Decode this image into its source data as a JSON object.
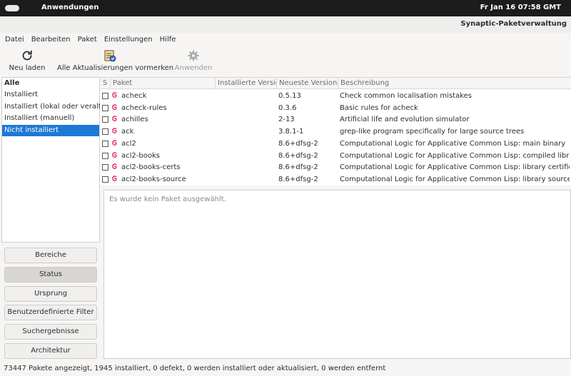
{
  "topbar": {
    "app_menu": "Anwendungen",
    "clock": "Fr Jan 16  07:58 GMT"
  },
  "window": {
    "title": "Synaptic-Paketverwaltung"
  },
  "menu": [
    "Datei",
    "Bearbeiten",
    "Paket",
    "Einstellungen",
    "Hilfe"
  ],
  "toolbar": {
    "reload": {
      "label": "Neu laden",
      "icon": "reload-icon"
    },
    "mark_all": {
      "label": "Alle Aktualisierungen vormerken",
      "icon": "mark-upgrades-icon"
    },
    "apply": {
      "label": "Anwenden",
      "icon": "gear-icon",
      "disabled": true
    }
  },
  "filters": {
    "header": "Alle",
    "items": [
      "Installiert",
      "Installiert (lokal oder veraltet)",
      "Installiert (manuell)",
      "Nicht installiert"
    ],
    "selected": "Nicht installiert"
  },
  "filter_buttons": [
    "Bereiche",
    "Status",
    "Ursprung",
    "Benutzerdefinierte Filter",
    "Suchergebnisse",
    "Architektur"
  ],
  "filter_buttons_active": "Status",
  "table": {
    "columns": [
      "S",
      "Paket",
      "Installierte Version",
      "Neueste Version",
      "Beschreibung"
    ],
    "rows": [
      {
        "package": "acheck",
        "installed": "",
        "latest": "0.5.13",
        "description": "Check common localisation mistakes"
      },
      {
        "package": "acheck-rules",
        "installed": "",
        "latest": "0.3.6",
        "description": "Basic rules for acheck"
      },
      {
        "package": "achilles",
        "installed": "",
        "latest": "2-13",
        "description": "Artificial life and evolution simulator"
      },
      {
        "package": "ack",
        "installed": "",
        "latest": "3.8.1-1",
        "description": "grep-like program specifically for large source trees"
      },
      {
        "package": "acl2",
        "installed": "",
        "latest": "8.6+dfsg-2",
        "description": "Computational Logic for Applicative Common Lisp: main binary"
      },
      {
        "package": "acl2-books",
        "installed": "",
        "latest": "8.6+dfsg-2",
        "description": "Computational Logic for Applicative Common Lisp: compiled libraries"
      },
      {
        "package": "acl2-books-certs",
        "installed": "",
        "latest": "8.6+dfsg-2",
        "description": "Computational Logic for Applicative Common Lisp: library certificates"
      },
      {
        "package": "acl2-books-source",
        "installed": "",
        "latest": "8.6+dfsg-2",
        "description": "Computational Logic for Applicative Common Lisp: library sources"
      }
    ]
  },
  "details": {
    "placeholder": "Es wurde kein Paket ausgewählt."
  },
  "status": "73447 Pakete angezeigt, 1945 installiert, 0 defekt, 0 werden installiert oder aktualisiert, 0 werden entfernt",
  "colors": {
    "selection": "#1e78d6",
    "debian_swirl": "#d70a53",
    "topbar": "#1c1c1c"
  }
}
